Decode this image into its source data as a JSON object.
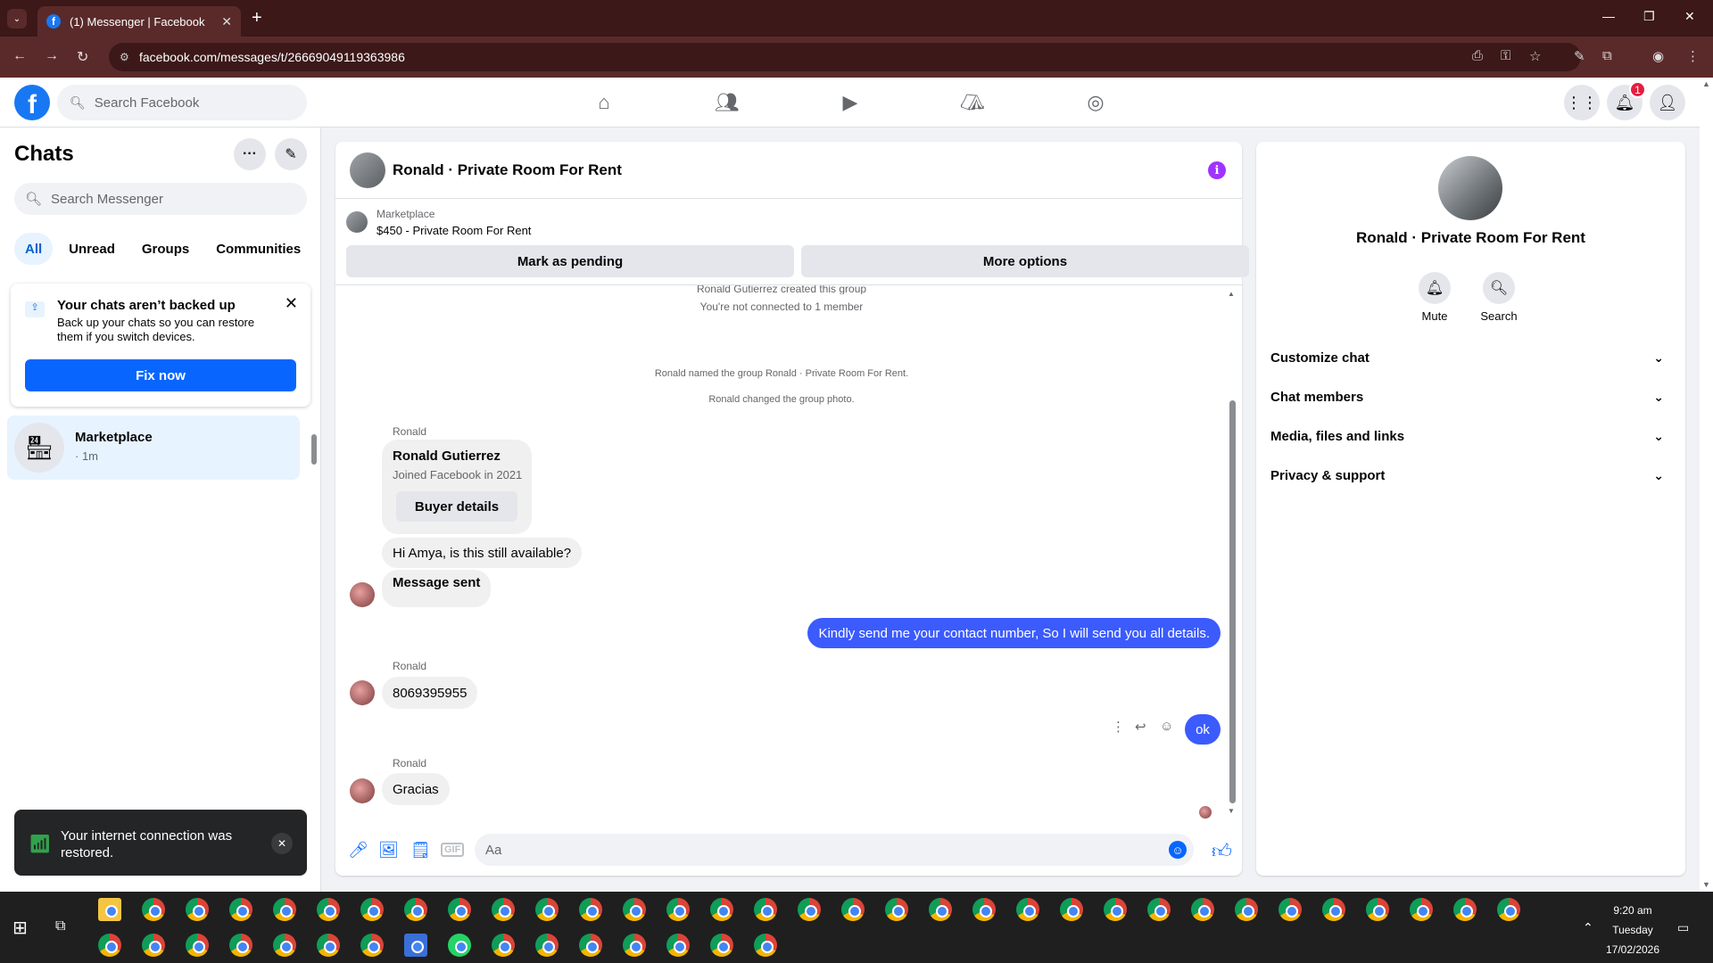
{
  "browser": {
    "tab_title": "(1) Messenger | Facebook",
    "url": "facebook.com/messages/t/26669049119363986"
  },
  "fb": {
    "search_placeholder": "Search Facebook",
    "notifications_count": "1"
  },
  "chats": {
    "title": "Chats",
    "search_placeholder": "Search Messenger",
    "filters": [
      "All",
      "Unread",
      "Groups",
      "Communities"
    ],
    "backup": {
      "title": "Your chats aren’t backed up",
      "desc": "Back up your chats so you can restore them if you switch devices.",
      "button": "Fix now"
    },
    "items": [
      {
        "name": "Marketplace",
        "snippet": "· 1m"
      }
    ],
    "toast": "Your internet connection was restored."
  },
  "conversation": {
    "title": "Ronald · Private Room For Rent",
    "marketplace_label": "Marketplace",
    "listing": "$450 - Private Room For Rent",
    "mark_pending": "Mark as pending",
    "more_options": "More options",
    "system": [
      "Ronald Gutierrez created this group",
      "You're not connected to 1 member",
      "Ronald named the group Ronald · Private Room For Rent.",
      "Ronald changed the group photo."
    ],
    "sender_name": "Ronald",
    "card": {
      "name": "Ronald Gutierrez",
      "joined": "Joined Facebook in 2021",
      "button": "Buyer details"
    },
    "messages": [
      "Hi Amya, is this still available?",
      "Message sent",
      "Kindly send me your contact number, So I will send you all details.",
      "8069395955",
      "ok",
      "Gracias"
    ],
    "composer_placeholder": "Aa"
  },
  "info_panel": {
    "title": "Ronald · Private Room For Rent",
    "mute": "Mute",
    "search": "Search",
    "sections": [
      "Customize chat",
      "Chat members",
      "Media, files and links",
      "Privacy & support"
    ]
  },
  "taskbar": {
    "time": "9:20 am",
    "day": "Tuesday",
    "date": "17/02/2026"
  },
  "colors": {
    "fb_blue": "#1877f2",
    "outgoing_bubble": "#3b5bfd",
    "browser_frame": "#5a2a2a"
  }
}
